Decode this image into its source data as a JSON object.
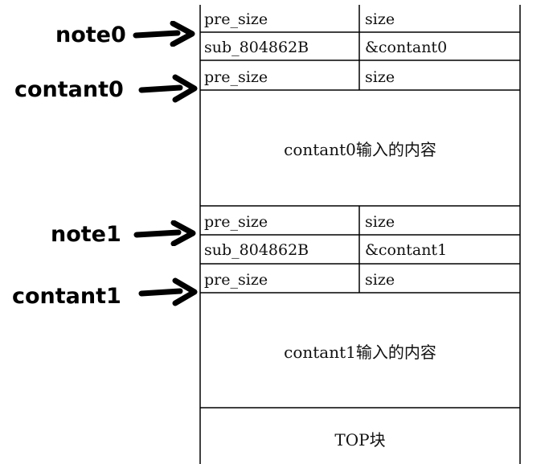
{
  "pointers": [
    {
      "label": "note0"
    },
    {
      "label": "contant0"
    },
    {
      "label": "note1"
    },
    {
      "label": "contant1"
    }
  ],
  "chunk0": {
    "header": {
      "pre_size": "pre_size",
      "size": "size"
    },
    "data": {
      "left": "sub_804862B",
      "right": "&contant0"
    }
  },
  "content0": {
    "header": {
      "pre_size": "pre_size",
      "size": "size"
    },
    "body": "contant0输入的内容"
  },
  "chunk1": {
    "header": {
      "pre_size": "pre_size",
      "size": "size"
    },
    "data": {
      "left": "sub_804862B",
      "right": "&contant1"
    }
  },
  "content1": {
    "header": {
      "pre_size": "pre_size",
      "size": "size"
    },
    "body": "contant1输入的内容"
  },
  "top_chunk": "TOP块"
}
